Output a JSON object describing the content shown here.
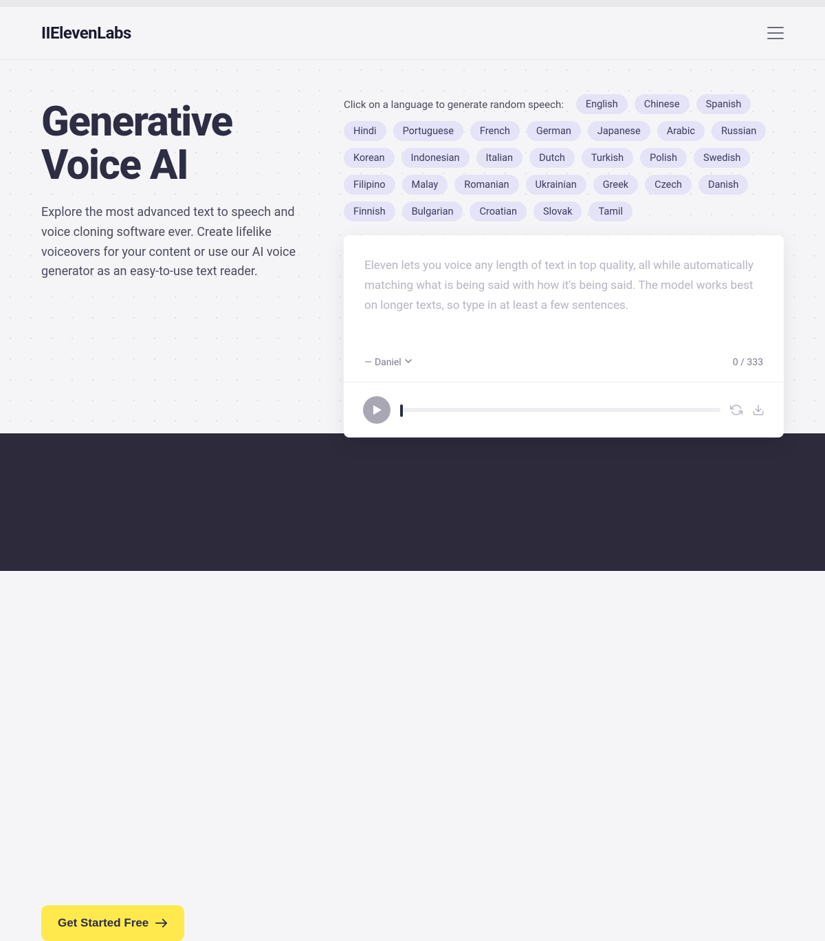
{
  "header": {
    "logo": "IIElevenLabs"
  },
  "hero": {
    "title": "Generative Voice AI",
    "subtitle": "Explore the most advanced text to speech and voice cloning software ever. Create lifelike voiceovers for your content or use our AI voice generator as an easy-to-use text reader."
  },
  "languages": {
    "prompt": "Click on a language to generate random speech:",
    "items": [
      "English",
      "Chinese",
      "Spanish",
      "Hindi",
      "Portuguese",
      "French",
      "German",
      "Japanese",
      "Arabic",
      "Russian",
      "Korean",
      "Indonesian",
      "Italian",
      "Dutch",
      "Turkish",
      "Polish",
      "Swedish",
      "Filipino",
      "Malay",
      "Romanian",
      "Ukrainian",
      "Greek",
      "Czech",
      "Danish",
      "Finnish",
      "Bulgarian",
      "Croatian",
      "Slovak",
      "Tamil"
    ]
  },
  "editor": {
    "placeholder": "Eleven lets you voice any length of text in top quality, all while automatically matching what is being said with how it's being said. The model works best on longer texts, so type in at least a few sentences.",
    "voice_prefix": "— ",
    "voice_name": "Daniel",
    "char_count": "0 / 333"
  },
  "cta": {
    "label": "Get Started Free"
  }
}
